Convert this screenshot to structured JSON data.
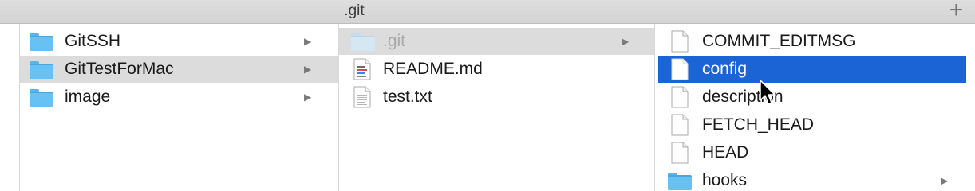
{
  "window": {
    "tab_title": ".git",
    "new_tab_label": "+"
  },
  "columns": {
    "col1": {
      "items": [
        {
          "label": "GitSSH",
          "type": "folder",
          "state": "normal",
          "has_children": true
        },
        {
          "label": "GitTestForMac",
          "type": "folder",
          "state": "selected-inactive",
          "has_children": true
        },
        {
          "label": "image",
          "type": "folder",
          "state": "normal",
          "has_children": true
        }
      ]
    },
    "col2": {
      "items": [
        {
          "label": ".git",
          "type": "folder",
          "state": "selected-inactive-hidden",
          "has_children": true
        },
        {
          "label": "README.md",
          "type": "markdown-file",
          "state": "normal",
          "has_children": false
        },
        {
          "label": "test.txt",
          "type": "text-file",
          "state": "normal",
          "has_children": false
        }
      ]
    },
    "col3": {
      "items": [
        {
          "label": "COMMIT_EDITMSG",
          "type": "file",
          "state": "normal",
          "has_children": false
        },
        {
          "label": "config",
          "type": "file",
          "state": "selected-active",
          "has_children": false
        },
        {
          "label": "description",
          "type": "file",
          "state": "normal",
          "has_children": false
        },
        {
          "label": "FETCH_HEAD",
          "type": "file",
          "state": "normal",
          "has_children": false
        },
        {
          "label": "HEAD",
          "type": "file",
          "state": "normal",
          "has_children": false
        },
        {
          "label": "hooks",
          "type": "folder",
          "state": "normal",
          "has_children": true
        }
      ]
    }
  },
  "glyphs": {
    "chevron": "▶"
  },
  "colors": {
    "selection_active": "#1a64d6",
    "selection_inactive": "#dcdcdc",
    "folder_blue": "#67c1f2"
  }
}
